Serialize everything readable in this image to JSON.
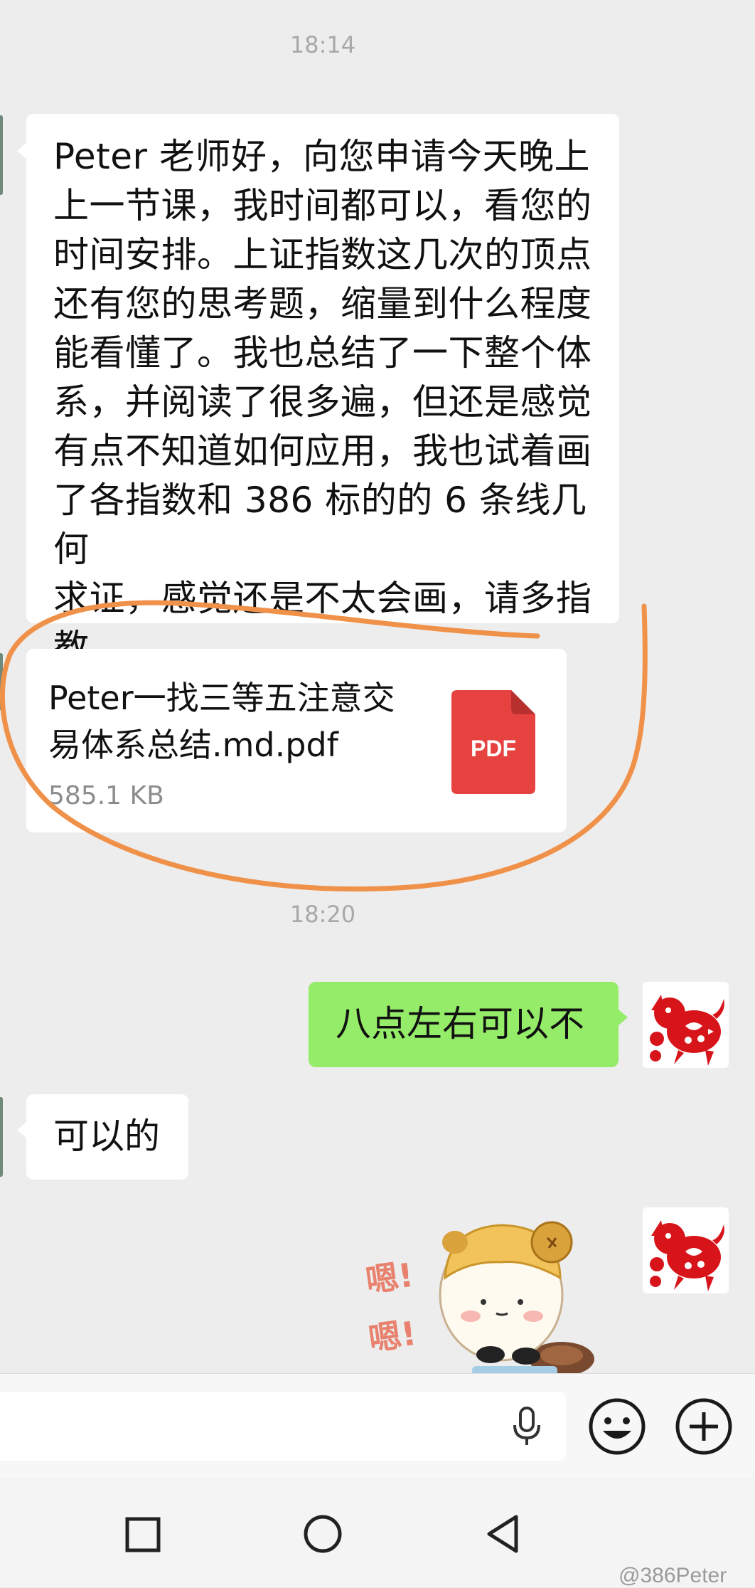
{
  "timestamps": [
    "18:14",
    "18:20"
  ],
  "messages": {
    "long_request": "Peter 老师好，向您申请今天晚上\n上一节课，我时间都可以，看您的\n时间安排。上证指数这几次的顶点\n还有您的思考题，缩量到什么程度\n能看懂了。我也总结了一下整个体\n系，并阅读了很多遍，但还是感觉\n有点不知道如何应用，我也试着画\n了各指数和 386 标的的 6 条线几何\n求证，感觉还是不太会画，请多指\n教",
    "file": {
      "name_line1": "Peter一找三等五注意交",
      "name_line2": "易体系总结.md.pdf",
      "size": "585.1 KB",
      "icon_label": "PDF"
    },
    "reply_sent": "八点左右可以不",
    "reply_received": "可以的",
    "sticker_text": [
      "嗯!",
      "嗯!"
    ]
  },
  "colors": {
    "annotation": "#f0914a",
    "pdf_red": "#e64340",
    "sent_bubble": "#95ec69",
    "avatar_red": "#d8141b"
  },
  "watermark": "@386Peter"
}
